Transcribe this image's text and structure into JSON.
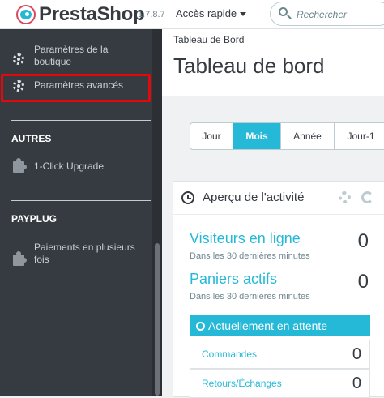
{
  "header": {
    "brand": "PrestaShop",
    "version": "1.7.8.7",
    "quick_access": "Accès rapide",
    "search_placeholder": "Rechercher"
  },
  "sidebar": {
    "items": [
      {
        "label": "Paramètres de la boutique",
        "icon": "gear-icon"
      },
      {
        "label": "Paramètres avancés",
        "icon": "gear-icon"
      }
    ],
    "sections": [
      {
        "title": "AUTRES",
        "items": [
          {
            "label": "1-Click Upgrade",
            "icon": "puzzle-icon"
          }
        ]
      },
      {
        "title": "PAYPLUG",
        "items": [
          {
            "label": "Paiements en plusieurs fois",
            "icon": "puzzle-icon"
          }
        ]
      }
    ]
  },
  "main": {
    "breadcrumb": "Tableau de Bord",
    "title": "Tableau de bord",
    "periods": [
      "Jour",
      "Mois",
      "Année",
      "Jour-1"
    ],
    "active_period": "Mois",
    "activity": {
      "title": "Aperçu de l'activité",
      "visitors_label": "Visiteurs en ligne",
      "visitors_sub": "Dans les 30 dernières minutes",
      "visitors_value": "0",
      "carts_label": "Paniers actifs",
      "carts_sub": "Dans les 30 dernières minutes",
      "carts_value": "0",
      "pending_title": "Actuellement en attente",
      "pending": [
        {
          "label": "Commandes",
          "value": "0"
        },
        {
          "label": "Retours/Échanges",
          "value": "0"
        }
      ]
    }
  },
  "colors": {
    "accent": "#25b9d7",
    "sidebar_bg": "#363a41",
    "highlight": "#e4080a"
  }
}
